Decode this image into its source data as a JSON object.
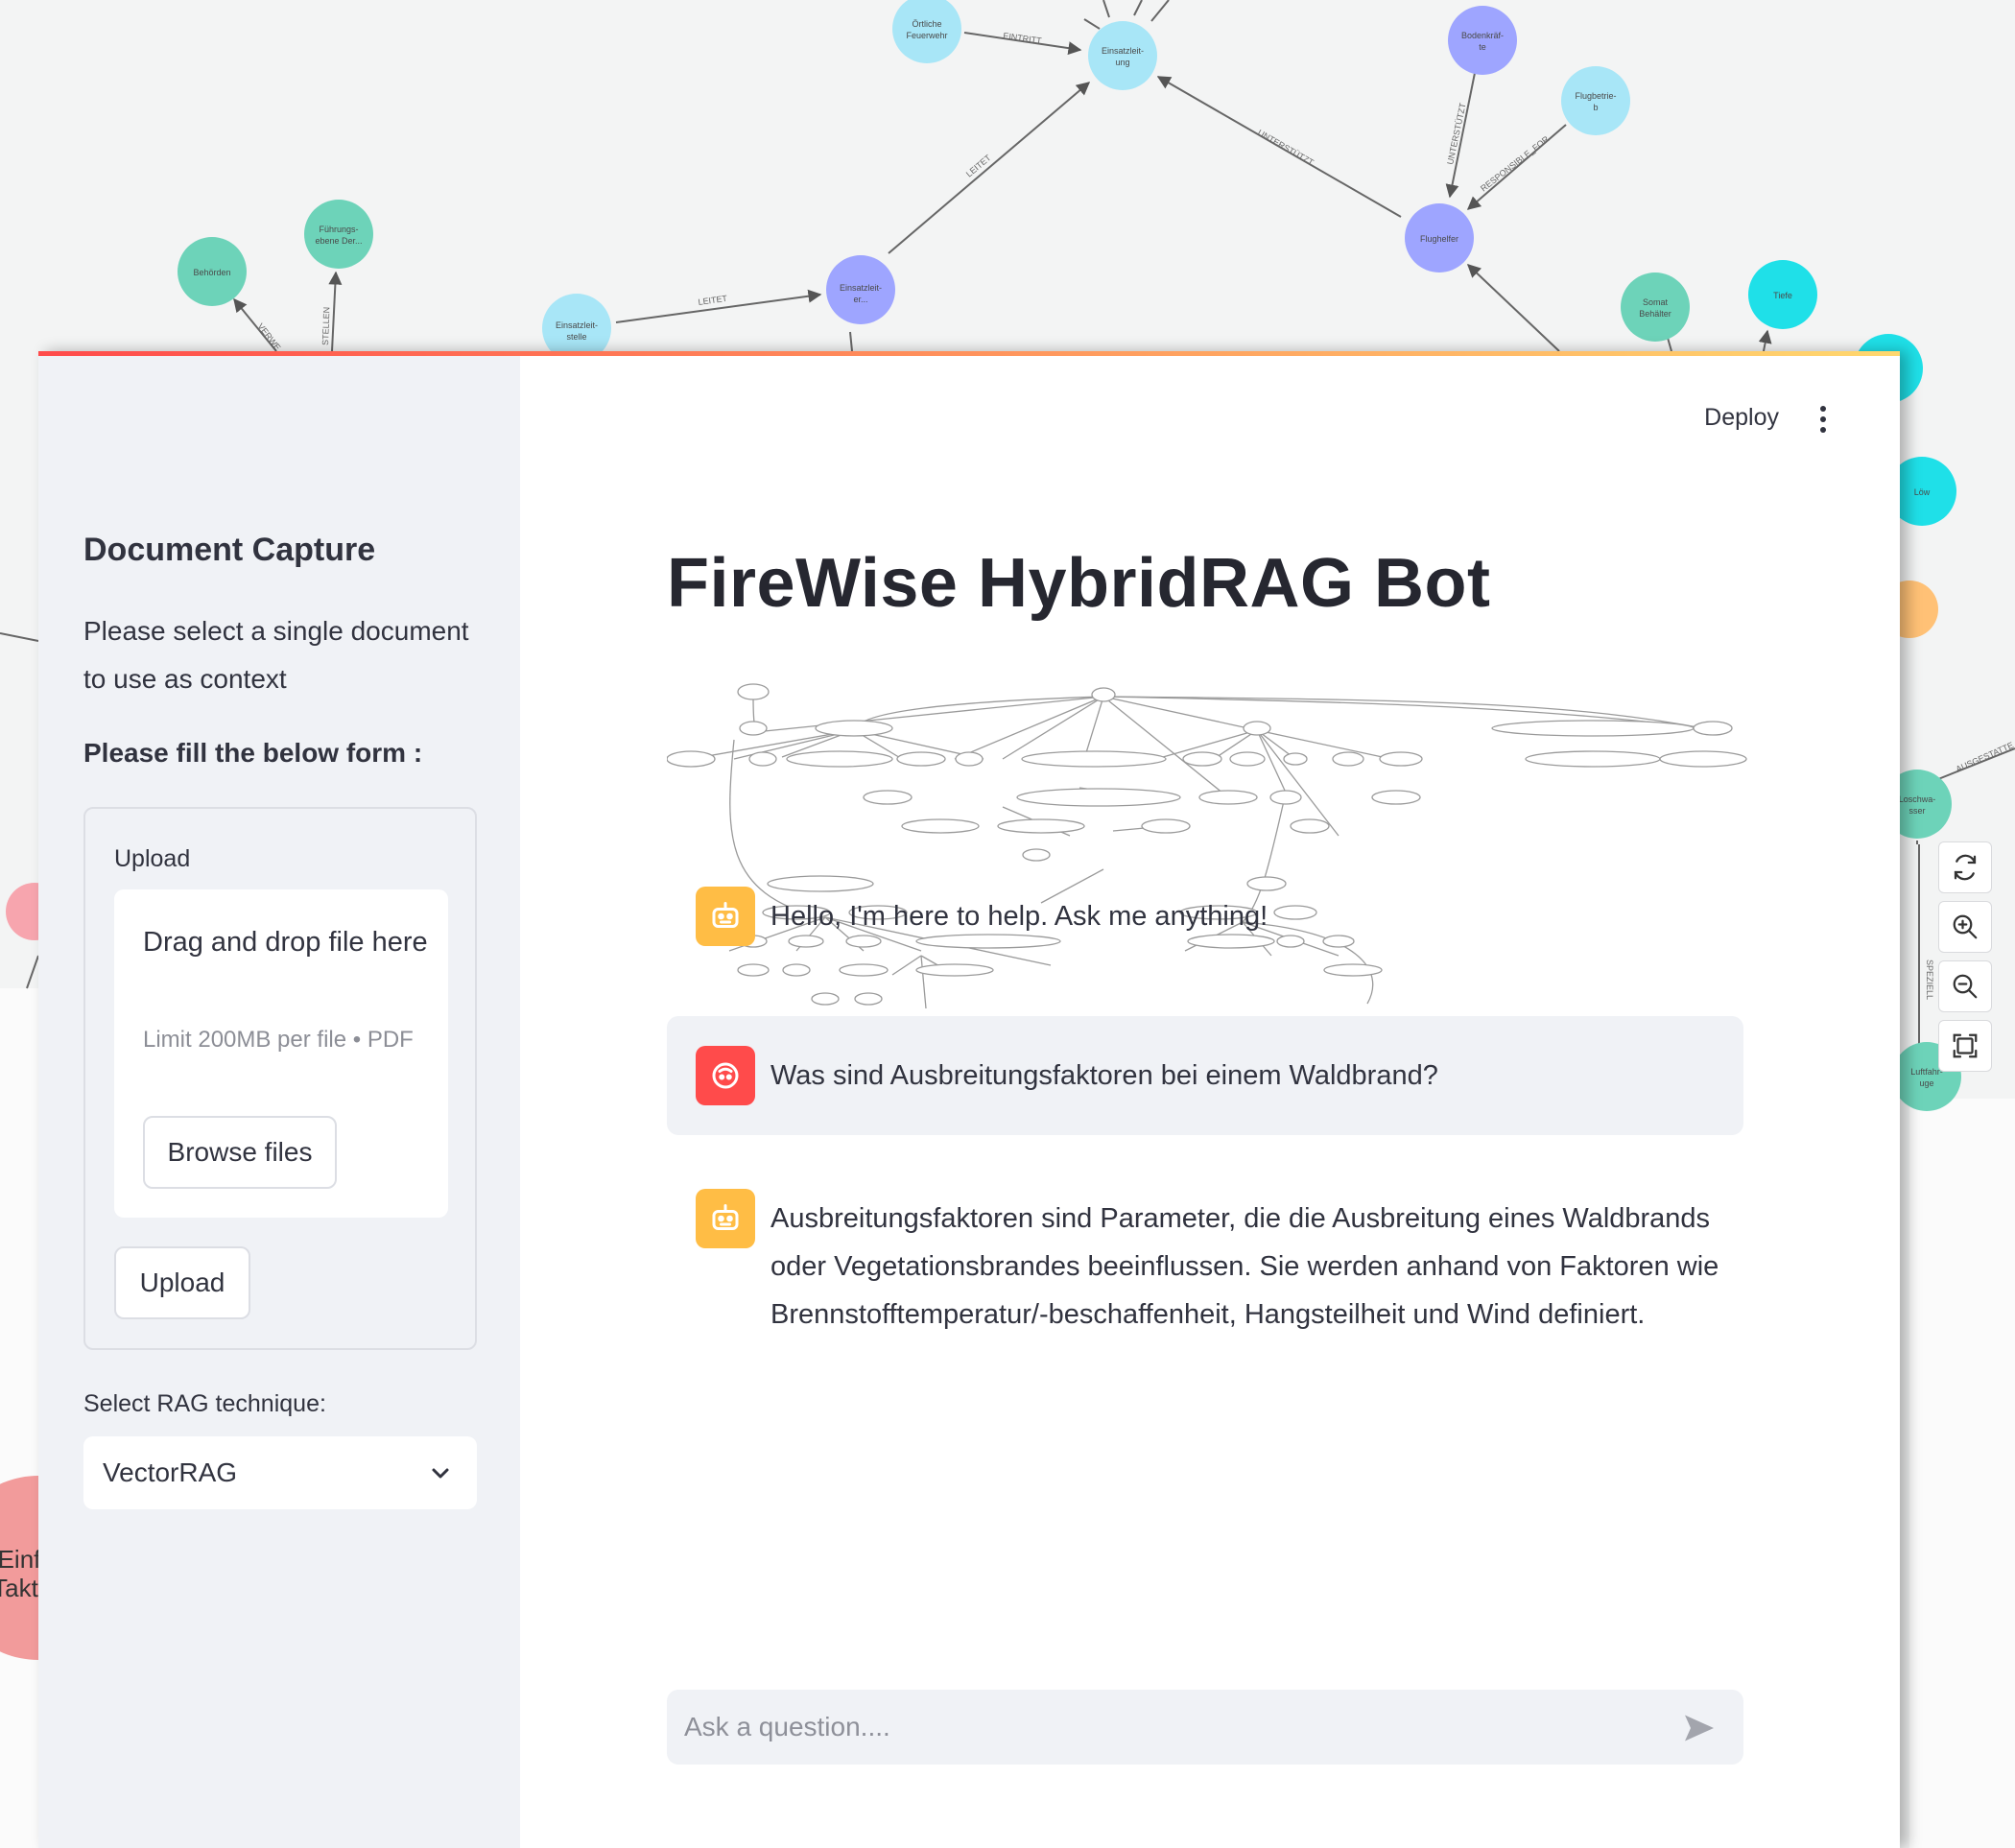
{
  "background_graph": {
    "node_labels": [
      "Örtliche Feuerwehr",
      "Einsatzleit-ung",
      "Bodenkräf-te",
      "Flugbetrie-b",
      "Flughelfer",
      "Führungs-ebene Der...",
      "Behörden",
      "Einsatzleit-stelle",
      "Einsatzleit-er...",
      "Somat Behälter",
      "Tiefe",
      "Löw",
      "Loschwa-sser",
      "Luftfahr-uge",
      "Einf Takt"
    ],
    "edge_labels": [
      "EINTRITT",
      "LEITET",
      "UNTERSTÜTZT",
      "UNTERSTÜTZT",
      "RESPONSIBLE_FOR",
      "LEITET",
      "VERWE",
      "STELLEN",
      "AUSGESTATTE",
      "SPEZIELL"
    ]
  },
  "graph_toolbar": {
    "refresh_icon": "refresh-icon",
    "zoom_in_icon": "zoom-in-icon",
    "zoom_out_icon": "zoom-out-icon",
    "fit_icon": "fit-view-icon"
  },
  "header": {
    "deploy_label": "Deploy",
    "menu_icon": "more-vertical-icon"
  },
  "sidebar": {
    "title": "Document Capture",
    "description": "Please select a single document to use as context",
    "form_title": "Please fill the below form :",
    "upload_label": "Upload",
    "dropzone_text": "Drag and drop file here",
    "dropzone_limit": "Limit 200MB per file • PDF",
    "browse_label": "Browse files",
    "upload_button_label": "Upload",
    "select_label": "Select RAG technique:",
    "select_value": "VectorRAG"
  },
  "main": {
    "title": "FireWise HybridRAG Bot",
    "messages": [
      {
        "role": "assistant",
        "text": "Hello, I'm here to help. Ask me anything!"
      },
      {
        "role": "user",
        "text": "Was sind Ausbreitungsfaktoren bei einem Waldbrand?"
      },
      {
        "role": "assistant",
        "text": "Ausbreitungsfaktoren sind Parameter, die die Ausbreitung eines Waldbrands oder Vegetationsbrandes beeinflussen. Sie werden anhand von Faktoren wie Brennstofftemperatur/-beschaffenheit, Hangsteilheit und Wind definiert."
      }
    ],
    "chat_placeholder": "Ask a question....",
    "send_icon": "send-icon"
  },
  "colors": {
    "accent_red": "#ff4b4b",
    "bot_avatar": "#ffbd45",
    "node_cyan": "#a8e6f7",
    "node_purple": "#9ea5ff",
    "node_teal": "#6dd3b9",
    "node_bright_cyan": "#1fe0e8"
  }
}
